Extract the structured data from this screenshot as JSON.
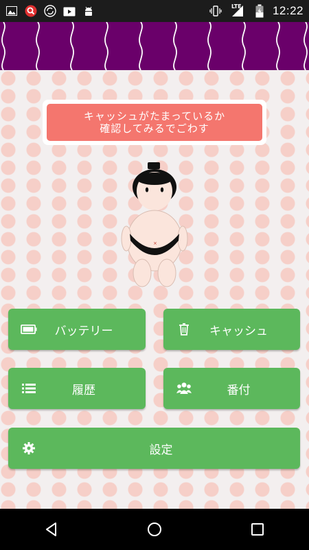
{
  "status_bar": {
    "time": "12:22",
    "network": "LTE",
    "left_icons": [
      "image-icon",
      "search-app-icon",
      "sync-icon",
      "media-icon",
      "android-icon"
    ],
    "right_icons": [
      "vibrate-icon",
      "signal-icon",
      "battery-charging-icon"
    ]
  },
  "banner": {
    "color": "#6a006a"
  },
  "message": {
    "line1": "キャッシュがたまっているか",
    "line2": "確認してみるでごわす"
  },
  "buttons": {
    "battery": {
      "label": "バッテリー",
      "icon": "battery-icon"
    },
    "cache": {
      "label": "キャッシュ",
      "icon": "trash-icon"
    },
    "history": {
      "label": "履歴",
      "icon": "list-icon"
    },
    "ranking": {
      "label": "番付",
      "icon": "group-icon"
    },
    "settings": {
      "label": "設定",
      "icon": "gear-icon"
    }
  },
  "colors": {
    "button": "#5cb85c",
    "bubble": "#f4766e",
    "dots": "#f6cfc8"
  },
  "nav": {
    "buttons": [
      "back-icon",
      "home-icon",
      "recents-icon"
    ]
  }
}
